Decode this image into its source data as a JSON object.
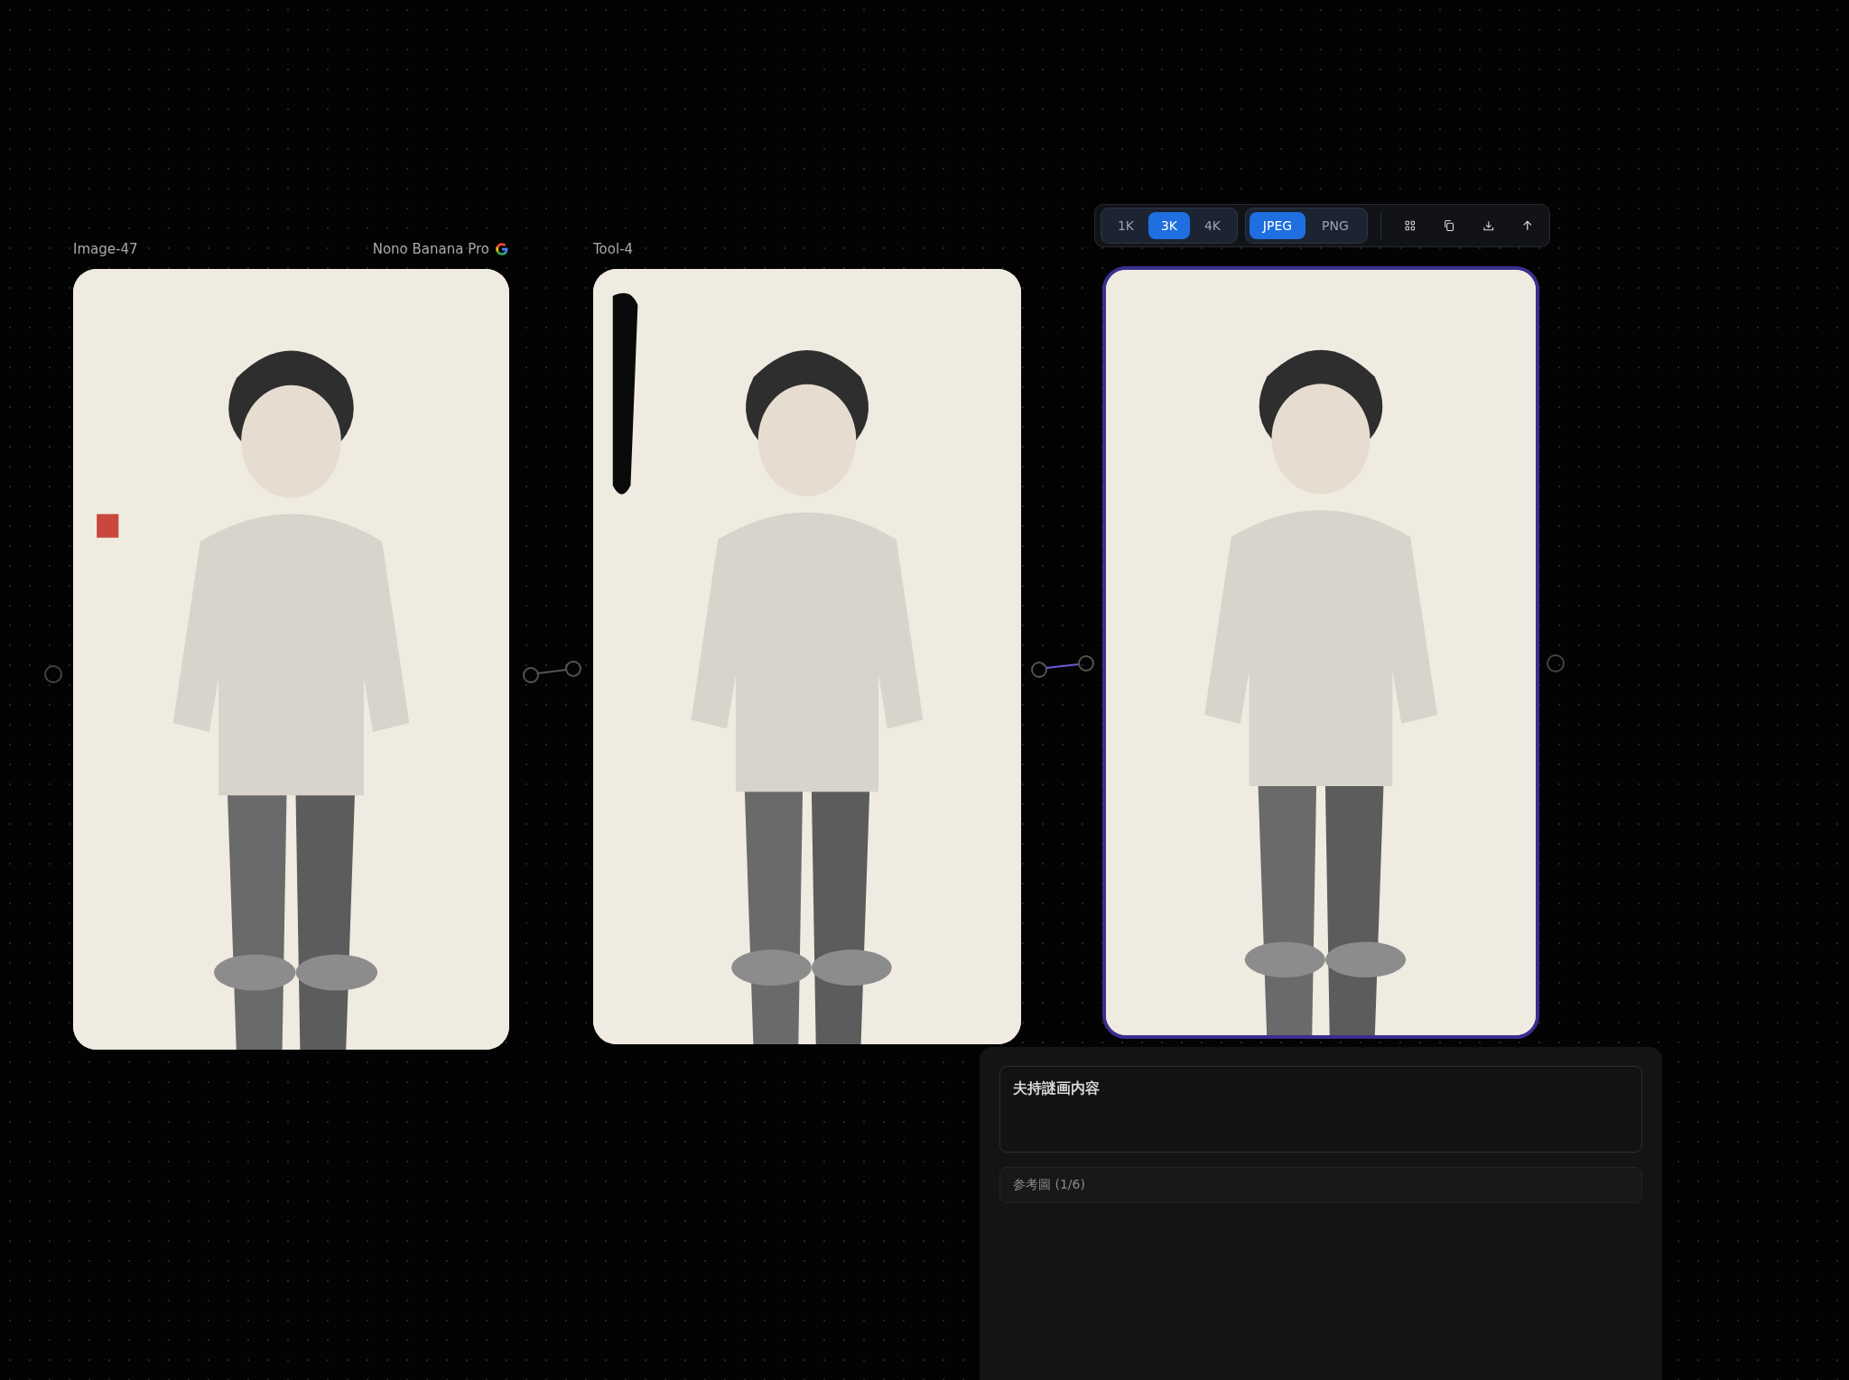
{
  "nodes": [
    {
      "title": "Image-47",
      "model": "Nono Banana Pro",
      "selected": false,
      "kind": "picture"
    },
    {
      "title": "Tool-4",
      "selected": false,
      "kind": "picture"
    },
    {
      "selected": true,
      "kind": "picture"
    }
  ],
  "toolbar": {
    "resolutions": [
      {
        "label": "1K",
        "selected": false
      },
      {
        "label": "3K",
        "selected": true
      },
      {
        "label": "4K",
        "selected": false
      }
    ],
    "formats": [
      {
        "label": "JPEG",
        "selected": true
      },
      {
        "label": "PNG",
        "selected": false
      }
    ]
  },
  "panel": {
    "prompt": {
      "placeholder": "夫持謎画内容"
    },
    "references": {
      "label": "参考圖 (1/6)"
    }
  }
}
